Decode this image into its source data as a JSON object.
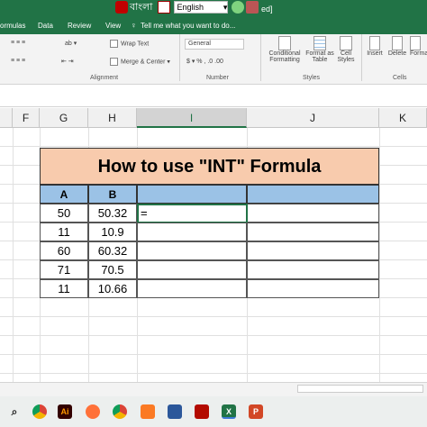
{
  "titlebar": {
    "bangla_label": "বাংলা",
    "language": "English",
    "right_text": "ed]"
  },
  "ribbon_tabs": [
    "ormulas",
    "Data",
    "Review",
    "View"
  ],
  "tell_me": "Tell me what you want to do...",
  "ribbon": {
    "wrap_text": "Wrap Text",
    "merge_center": "Merge & Center",
    "number_format": "General",
    "conditional_formatting": [
      "Conditional",
      "Formatting"
    ],
    "format_as_table": [
      "Format as",
      "Table"
    ],
    "cell_styles": [
      "Cell",
      "Styles"
    ],
    "insert": "Insert",
    "delete": "Delete",
    "format": "Format",
    "groups": {
      "alignment": "Alignment",
      "number": "Number",
      "styles": "Styles",
      "cells": "Cells"
    }
  },
  "columns": [
    "F",
    "G",
    "H",
    "I",
    "J",
    "K"
  ],
  "active_column": "I",
  "table": {
    "title": "How to use \"INT\" Formula",
    "headers": [
      "A",
      "B",
      "",
      ""
    ],
    "rows": [
      [
        "50",
        "50.32",
        "="
      ],
      [
        "11",
        "10.9",
        ""
      ],
      [
        "60",
        "60.32",
        ""
      ],
      [
        "71",
        "70.5",
        ""
      ],
      [
        "11",
        "10.66",
        ""
      ]
    ]
  },
  "colors": {
    "excel_green": "#217346",
    "title_fill": "#f8cbad",
    "header_fill": "#9bc2e6"
  },
  "taskbar_icons": [
    "search-icon",
    "chrome-icon",
    "illustrator-icon",
    "firefox-icon",
    "chrome-icon",
    "xampp-icon",
    "store-icon",
    "acrobat-icon",
    "excel-icon",
    "powerpoint-icon"
  ]
}
